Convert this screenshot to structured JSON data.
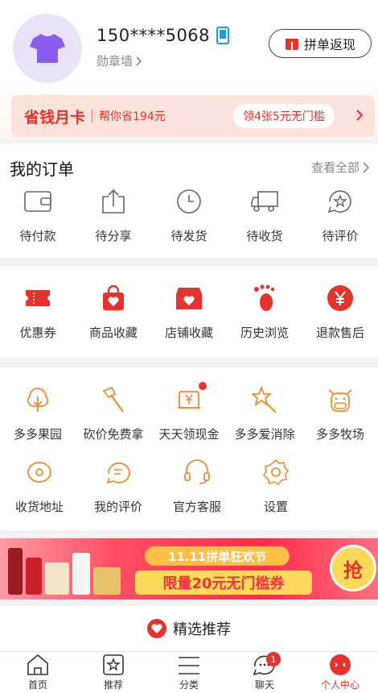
{
  "profile": {
    "phone": "150****5068",
    "medal_wall": "勋章墙",
    "refund_button": "拼单返现"
  },
  "monthly_card": {
    "title": "省钱月卡",
    "subtitle": "帮你省194元",
    "coupon_pill": "领4张5元无门槛"
  },
  "orders": {
    "title": "我的订单",
    "see_all": "查看全部",
    "items": [
      {
        "label": "待付款",
        "icon": "wallet-icon"
      },
      {
        "label": "待分享",
        "icon": "share-icon"
      },
      {
        "label": "待发货",
        "icon": "clock-icon"
      },
      {
        "label": "待收货",
        "icon": "truck-icon"
      },
      {
        "label": "待评价",
        "icon": "review-icon"
      }
    ]
  },
  "shortcuts": {
    "items": [
      {
        "label": "优惠券",
        "icon": "coupon-icon"
      },
      {
        "label": "商品收藏",
        "icon": "bag-heart-icon"
      },
      {
        "label": "店铺收藏",
        "icon": "store-heart-icon"
      },
      {
        "label": "历史浏览",
        "icon": "footprint-icon"
      },
      {
        "label": "退款售后",
        "icon": "yen-icon"
      }
    ]
  },
  "services": {
    "row1": [
      {
        "label": "多多果园",
        "icon": "tree-icon"
      },
      {
        "label": "砍价免费拿",
        "icon": "axe-icon"
      },
      {
        "label": "天天领现金",
        "icon": "cash-icon"
      },
      {
        "label": "多多爱消除",
        "icon": "star-wand-icon"
      },
      {
        "label": "多多牧场",
        "icon": "cow-icon"
      }
    ],
    "row2": [
      {
        "label": "收货地址",
        "icon": "location-icon"
      },
      {
        "label": "我的评价",
        "icon": "comment-icon"
      },
      {
        "label": "官方客服",
        "icon": "headset-icon"
      },
      {
        "label": "设置",
        "icon": "gear-icon"
      }
    ]
  },
  "banner": {
    "top_text": "11.11拼单狂欢节",
    "main_text": "限量20元无门槛券",
    "grab": "抢"
  },
  "recommend": {
    "label": "精选推荐"
  },
  "tabbar": {
    "items": [
      {
        "label": "首页",
        "icon": "home-icon"
      },
      {
        "label": "推荐",
        "icon": "star-box-icon"
      },
      {
        "label": "分类",
        "icon": "list-icon"
      },
      {
        "label": "聊天",
        "icon": "chat-icon",
        "badge": "1"
      },
      {
        "label": "个人中心",
        "icon": "face-icon"
      }
    ]
  },
  "colors": {
    "accent": "#e5322d",
    "icon_orange": "#f28a2e",
    "avatar_bg": "#e9e2f8",
    "avatar_shirt": "#8a5cf0"
  }
}
